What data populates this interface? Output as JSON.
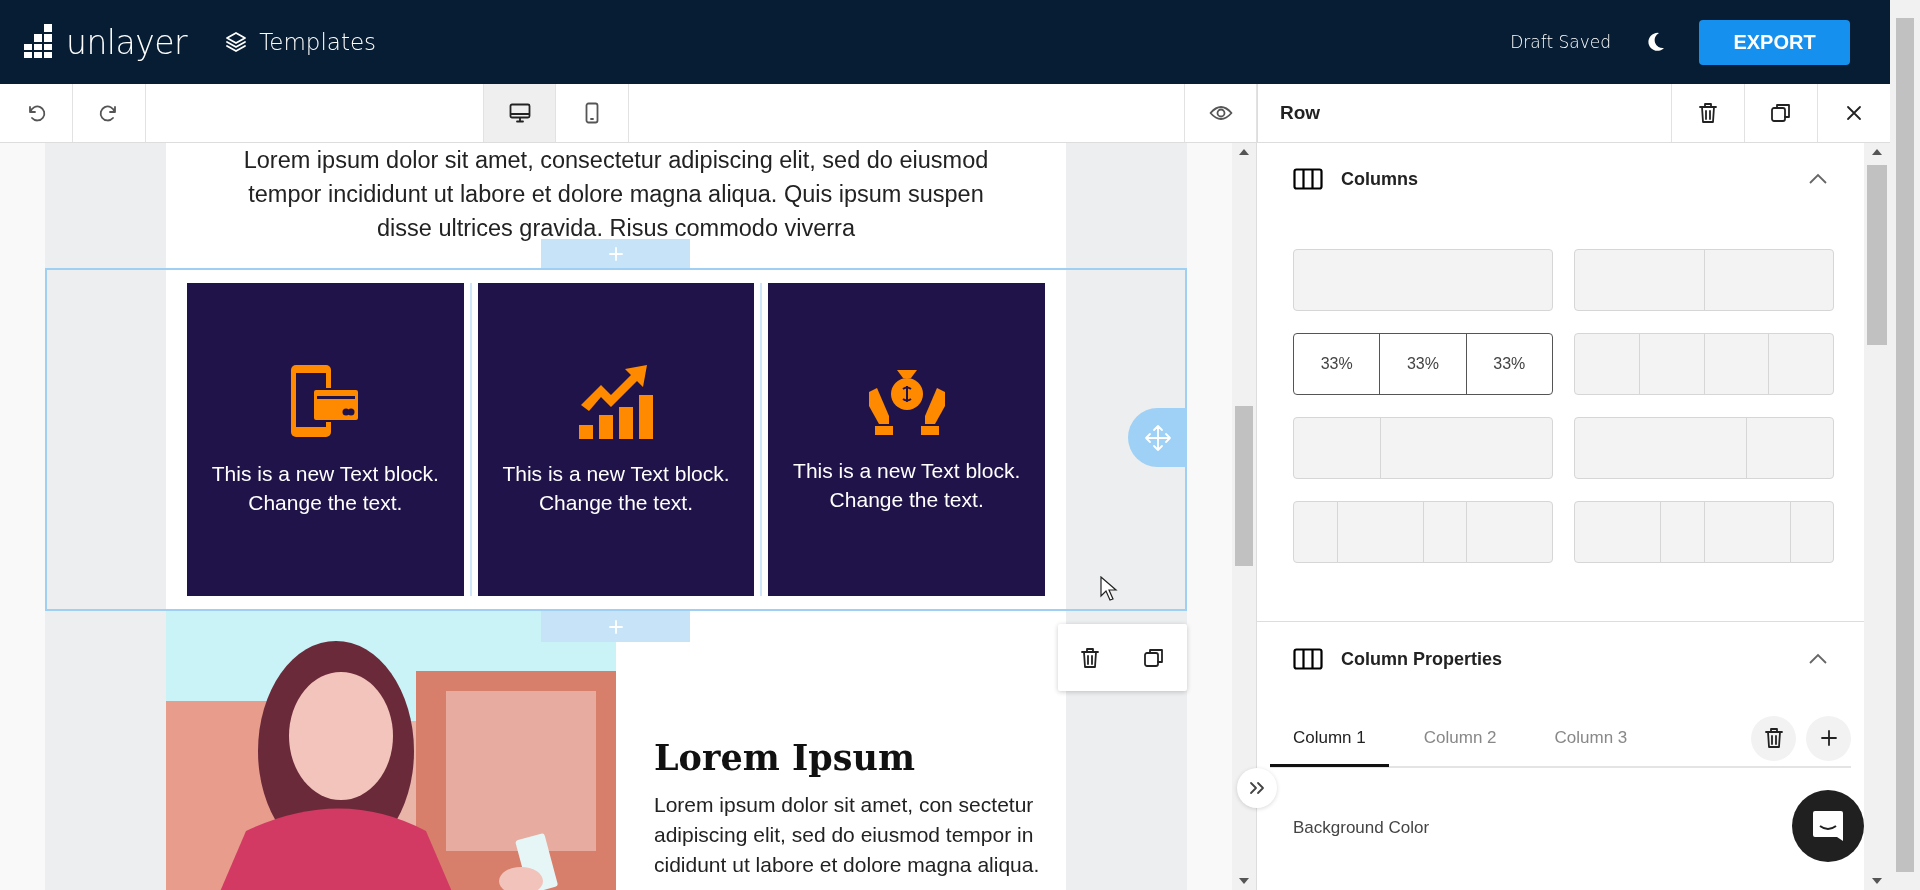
{
  "header": {
    "logo_text": "unlayer",
    "templates": "Templates",
    "status": "Draft Saved",
    "export": "EXPORT"
  },
  "toolbar": {
    "devices": [
      {
        "kind": "desktop",
        "selected": true
      },
      {
        "kind": "mobile",
        "selected": false
      }
    ]
  },
  "canvas": {
    "intro": "Lorem ipsum dolor sit amet, consectetur adipiscing elit, sed do eiusmod tempor incididunt ut labore et dolore magna aliqua. Quis ipsum suspen disse ultrices gravida. Risus commodo viverra",
    "cards": [
      {
        "kind": "phone-card",
        "text": "This is a new Text block.\nChange the text."
      },
      {
        "kind": "growth-chart",
        "text": "This is a new Text block.\nChange the text."
      },
      {
        "kind": "money-bag",
        "text": "This is a new Text block.\nChange the text."
      }
    ],
    "hero": {
      "kind": "picture",
      "heading": "Lorem Ipsum",
      "paragraph": "Lorem ipsum dolor sit amet, con sectetur adipiscing elit, sed do eiusmod tempor in cididunt ut labore et dolore magna aliqua."
    }
  },
  "panel": {
    "title": "Row",
    "columns_section": {
      "title": "Columns",
      "expanded": true,
      "layouts": [
        {
          "kind": "full",
          "selected": false
        },
        {
          "kind": "halves",
          "selected": false
        },
        {
          "kind": "thirds",
          "selected": true,
          "labels": [
            "33%",
            "33%",
            "33%"
          ]
        },
        {
          "kind": "quarters",
          "selected": false
        },
        {
          "kind": "third-left",
          "selected": false
        },
        {
          "kind": "third-right",
          "selected": false
        },
        {
          "kind": "mixed-left",
          "selected": false
        },
        {
          "kind": "mixed-right",
          "selected": false
        }
      ]
    },
    "properties_section": {
      "title": "Column Properties",
      "expanded": true,
      "tabs": [
        {
          "label": "Column 1",
          "selected": true
        },
        {
          "label": "Column 2",
          "selected": false
        },
        {
          "label": "Column 3",
          "selected": false
        }
      ],
      "field_label": "Background Color"
    }
  }
}
